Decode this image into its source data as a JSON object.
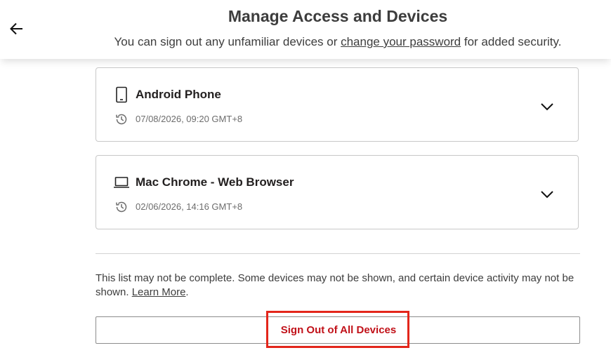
{
  "header": {
    "title": "Manage Access and Devices",
    "subtitle_before": "You can sign out any unfamiliar devices or ",
    "subtitle_link": "change your password",
    "subtitle_after": " for added security.",
    "back_icon": "arrow-left-icon"
  },
  "devices": [
    {
      "name": "Android Phone",
      "last_active": "07/08/2026, 09:20 GMT+8",
      "icon": "phone-icon"
    },
    {
      "name": "Mac Chrome - Web Browser",
      "last_active": "02/06/2026, 14:16 GMT+8",
      "icon": "laptop-icon"
    }
  ],
  "footer": {
    "disclaimer_before": "This list may not be complete. Some devices may not be shown, and certain device activity may not be shown. ",
    "learn_more": "Learn More",
    "disclaimer_after": ".",
    "sign_out_all_label": "Sign Out of All Devices"
  },
  "colors": {
    "accent_red": "#c11119",
    "highlight_red": "#e3261b"
  }
}
